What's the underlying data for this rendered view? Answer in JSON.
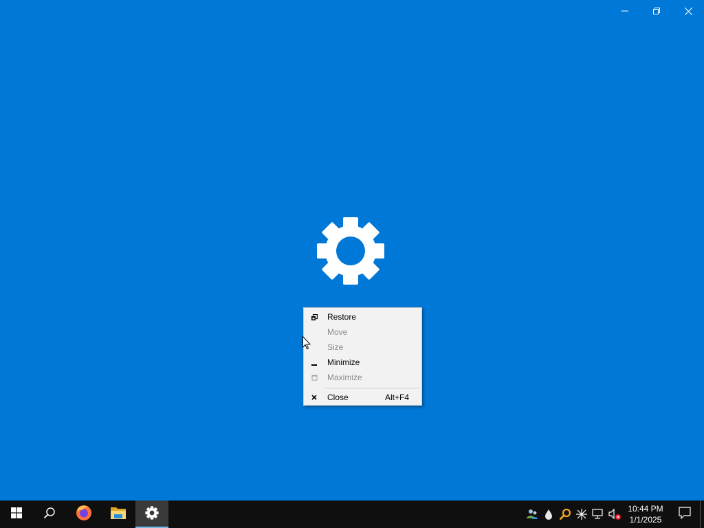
{
  "window": {
    "caption_buttons": [
      {
        "id": "minimize",
        "icon": "minimize-icon"
      },
      {
        "id": "restore",
        "icon": "restore-icon"
      },
      {
        "id": "close",
        "icon": "close-icon"
      }
    ],
    "background_color": "#0078d7",
    "splash_icon": "gear-icon"
  },
  "system_menu": {
    "items": [
      {
        "label": "Restore",
        "icon": "restore-small-icon",
        "enabled": true,
        "shortcut": ""
      },
      {
        "label": "Move",
        "icon": "",
        "enabled": false,
        "shortcut": ""
      },
      {
        "label": "Size",
        "icon": "",
        "enabled": false,
        "shortcut": ""
      },
      {
        "label": "Minimize",
        "icon": "minimize-small-icon",
        "enabled": true,
        "shortcut": ""
      },
      {
        "label": "Maximize",
        "icon": "maximize-small-icon",
        "enabled": false,
        "shortcut": ""
      },
      {
        "label": "Close",
        "icon": "close-small-icon",
        "enabled": true,
        "shortcut": "Alt+F4"
      }
    ]
  },
  "taskbar": {
    "apps": [
      {
        "name": "start",
        "icon": "windows-logo-icon"
      },
      {
        "name": "search",
        "icon": "search-icon"
      },
      {
        "name": "firefox",
        "icon": "firefox-icon"
      },
      {
        "name": "file-explorer",
        "icon": "folder-icon"
      },
      {
        "name": "settings",
        "icon": "gear-icon",
        "active": true
      }
    ],
    "tray_icons": [
      "people-icon",
      "droplet-icon",
      "magnifier-icon",
      "sparkle-icon",
      "network-icon",
      "volume-muted-icon"
    ],
    "clock": {
      "time": "10:44 PM",
      "date": "1/1/2025"
    },
    "notification_icon": "action-center-icon",
    "accent_color": "#76b9ed"
  }
}
